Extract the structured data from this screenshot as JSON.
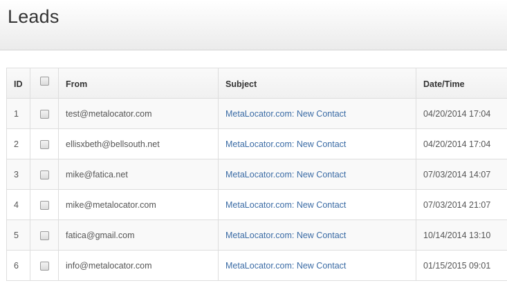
{
  "page": {
    "title": "Leads"
  },
  "table": {
    "columns": [
      "ID",
      "",
      "From",
      "Subject",
      "Date/Time"
    ],
    "rows": [
      {
        "id": "1",
        "from": "test@metalocator.com",
        "subject": "MetaLocator.com: New Contact",
        "datetime": "04/20/2014 17:04"
      },
      {
        "id": "2",
        "from": "ellisxbeth@bellsouth.net",
        "subject": "MetaLocator.com: New Contact",
        "datetime": "04/20/2014 17:04"
      },
      {
        "id": "3",
        "from": "mike@fatica.net",
        "subject": "MetaLocator.com: New Contact",
        "datetime": "07/03/2014 14:07"
      },
      {
        "id": "4",
        "from": "mike@metalocator.com",
        "subject": "MetaLocator.com: New Contact",
        "datetime": "07/03/2014 21:07"
      },
      {
        "id": "5",
        "from": "fatica@gmail.com",
        "subject": "MetaLocator.com: New Contact",
        "datetime": "10/14/2014 13:10"
      },
      {
        "id": "6",
        "from": "info@metalocator.com",
        "subject": "MetaLocator.com: New Contact",
        "datetime": "01/15/2015 09:01"
      }
    ]
  },
  "colors": {
    "link": "#3a6ba5",
    "text": "#555555",
    "title": "#333333"
  }
}
